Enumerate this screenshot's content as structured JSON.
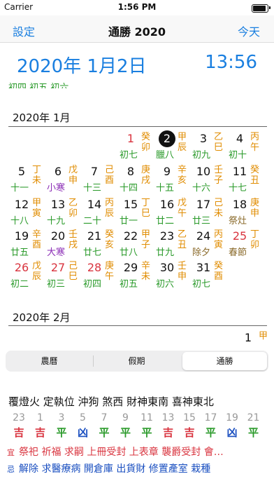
{
  "status": {
    "carrier": "Carrier",
    "time": "1:56 PM"
  },
  "nav": {
    "left": "設定",
    "title": "通勝 2020",
    "right": "今天"
  },
  "header": {
    "date": "2020年 1月2日",
    "clock": "13:56"
  },
  "cut_row": "初四   初五   初六",
  "jan": {
    "title": "2020年 1月",
    "days": [
      {
        "d": "1",
        "lunar": "初七",
        "gz": "癸卯",
        "dclass": "red"
      },
      {
        "d": "2",
        "lunar": "臘八",
        "gz": "甲辰",
        "today": true
      },
      {
        "d": "3",
        "lunar": "初九",
        "gz": "乙巳"
      },
      {
        "d": "4",
        "lunar": "初十",
        "gz": "丙午"
      },
      {
        "d": "5",
        "lunar": "十一",
        "gz": "丁未"
      },
      {
        "d": "6",
        "lunar": "小寒",
        "gz": "戊申",
        "lclass": "term"
      },
      {
        "d": "7",
        "lunar": "十三",
        "gz": "己酉"
      },
      {
        "d": "8",
        "lunar": "十四",
        "gz": "庚戌"
      },
      {
        "d": "9",
        "lunar": "十五",
        "gz": "辛亥"
      },
      {
        "d": "10",
        "lunar": "十六",
        "gz": "壬子"
      },
      {
        "d": "11",
        "lunar": "十七",
        "gz": "癸丑"
      },
      {
        "d": "12",
        "lunar": "十八",
        "gz": "甲寅"
      },
      {
        "d": "13",
        "lunar": "十九",
        "gz": "乙卯"
      },
      {
        "d": "14",
        "lunar": "二十",
        "gz": "丙辰"
      },
      {
        "d": "15",
        "lunar": "廿一",
        "gz": "丁巳"
      },
      {
        "d": "16",
        "lunar": "廿二",
        "gz": "戊午"
      },
      {
        "d": "17",
        "lunar": "廿三",
        "gz": "己未"
      },
      {
        "d": "18",
        "lunar": "祭灶",
        "gz": "庚申",
        "lclass": "fest"
      },
      {
        "d": "19",
        "lunar": "廿五",
        "gz": "辛酉"
      },
      {
        "d": "20",
        "lunar": "大寒",
        "gz": "壬戌",
        "lclass": "term"
      },
      {
        "d": "21",
        "lunar": "廿七",
        "gz": "癸亥"
      },
      {
        "d": "22",
        "lunar": "廿八",
        "gz": "甲子"
      },
      {
        "d": "23",
        "lunar": "廿九",
        "gz": "乙丑"
      },
      {
        "d": "24",
        "lunar": "除夕",
        "gz": "丙寅",
        "lclass": "fest"
      },
      {
        "d": "25",
        "lunar": "春節",
        "gz": "丁卯",
        "dclass": "red",
        "lclass": "fest"
      },
      {
        "d": "26",
        "lunar": "初二",
        "gz": "戊辰",
        "dclass": "red"
      },
      {
        "d": "27",
        "lunar": "初三",
        "gz": "己巳",
        "dclass": "red"
      },
      {
        "d": "28",
        "lunar": "初四",
        "gz": "庚午",
        "dclass": "red"
      },
      {
        "d": "29",
        "lunar": "初五",
        "gz": "辛未"
      },
      {
        "d": "30",
        "lunar": "初六",
        "gz": "壬申"
      },
      {
        "d": "31",
        "lunar": "初七",
        "gz": "癸酉"
      }
    ]
  },
  "feb": {
    "title": "2020年 2月",
    "first_day": "1",
    "first_gz": "甲"
  },
  "tabs": [
    "農曆",
    "假期",
    "通勝"
  ],
  "almanac": {
    "info": "覆燈火 定執位  沖狗 煞西  財神東南 喜神東北",
    "hours": [
      {
        "n": "23",
        "v": "吉",
        "c": "good"
      },
      {
        "n": "1",
        "v": "吉",
        "c": "good"
      },
      {
        "n": "3",
        "v": "平",
        "c": "ok"
      },
      {
        "n": "5",
        "v": "凶",
        "c": "bad"
      },
      {
        "n": "7",
        "v": "平",
        "c": "ok"
      },
      {
        "n": "9",
        "v": "平",
        "c": "ok"
      },
      {
        "n": "11",
        "v": "平",
        "c": "ok"
      },
      {
        "n": "13",
        "v": "吉",
        "c": "good"
      },
      {
        "n": "15",
        "v": "吉",
        "c": "good"
      },
      {
        "n": "17",
        "v": "平",
        "c": "ok"
      },
      {
        "n": "19",
        "v": "凶",
        "c": "bad"
      },
      {
        "n": "21",
        "v": "平",
        "c": "ok"
      }
    ],
    "yi_label": "宜",
    "yi": "祭祀 祈福 求嗣 上冊受封 上表章 襲爵受封 會…",
    "ji_label": "忌",
    "ji": "解除 求醫療病 開倉庫 出貨財 修置產室 栽種"
  }
}
